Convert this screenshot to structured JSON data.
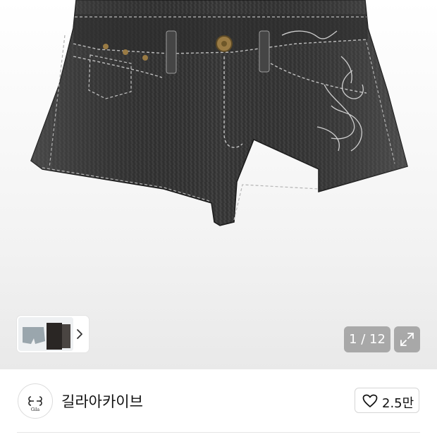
{
  "gallery": {
    "image_counter": "1 / 12",
    "main_image": "denim-shorts-product-photo",
    "thumbnail_image": "denim-shorts-thumbnails",
    "next_icon": "chevron-right-icon",
    "expand_icon": "expand-icon"
  },
  "shop": {
    "name": "길라아카이브",
    "logo_text": "Gila",
    "like_icon": "heart-outline-icon",
    "like_count": "2.5만"
  }
}
